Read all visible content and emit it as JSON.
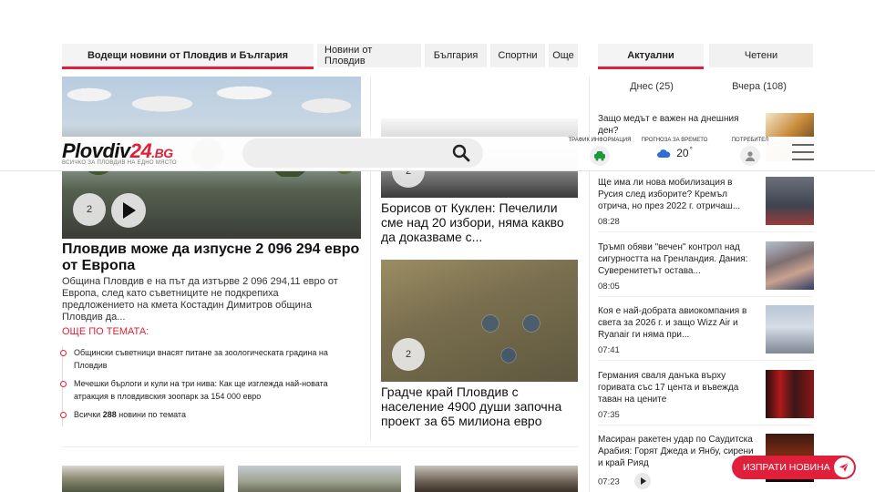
{
  "tabs": {
    "main": "Водещи новини от Пловдив и България",
    "plovdiv": "Новини от Пловдив",
    "bulgaria": "България",
    "sports": "Спортни",
    "more": "Още"
  },
  "right_tabs": {
    "current": "Актуални",
    "read": "Четени"
  },
  "days": {
    "today": "Днес (25)",
    "yesterday": "Вчера (108)"
  },
  "header": {
    "logo_main": "Plovdiv",
    "logo_num": "24",
    "logo_bg": ".BG",
    "logo_sub": "ВСИЧКО ЗА ПЛОВДИВ НА ЕДНО МЯСТО",
    "search_placeholder": "",
    "traffic_label": "ТРАФИК ИНФОРМАЦИЯ",
    "weather_label": "ПРОГНОЗА ЗА ВРЕМЕТО",
    "temperature": "20",
    "temperature_unit": "°",
    "user_label": "ПОТРЕБИТЕЛ"
  },
  "main_article": {
    "comments": "2",
    "title": "Пловдив може да изпусне 2 096 294 евро от Европа",
    "lead": "Община Пловдив е на път да изтърве 2 096 294,11 евро от Европа, след като съветниците не подкрепиха предложението на кмета Костадин Димитров община Пловдив да...",
    "related_header": "ОЩЕ ПО ТЕМАТА:",
    "related": [
      "Общински съветници внасят питане за зоологическата градина на Пловдив",
      "Мечешки бърлоги и кули на три нива: Как ще изглежда най-новата атракция в пловдивския зоопарк за 154 000 евро"
    ],
    "all_prefix": "Всички",
    "all_count": "288",
    "all_suffix": "новини по темата"
  },
  "mid_articles": [
    {
      "comments": "2",
      "title": "Борисов от Куклен: Печелили сме над 20 избори, няма какво да доказваме с..."
    },
    {
      "comments": "2",
      "title": "Градче край Пловдив с население 4900 души започна проект за 65 милиона евро"
    }
  ],
  "news": [
    {
      "title": "Защо медът е важен на днешния ден?",
      "time": ""
    },
    {
      "title": "Ще има ли нова мобилизация в Русия след изборите? Кремъл отрича, но през 2022 г. отричаш...",
      "time": "08:28"
    },
    {
      "title": "Тръмп обяви \"вечен\" контрол над сигурността на Гренландия. Дания: Суверенитетът остава...",
      "time": "08:05"
    },
    {
      "title": "Коя е най-добрата авиокомпания в света за 2026 г. и защо Wizz Air и Ryanair ги няма при...",
      "time": "07:41"
    },
    {
      "title": "Германия сваля данъка върху горивата със 17 цента и въвежда таван на цените",
      "time": "07:35"
    },
    {
      "title": "Масиран ракетен удар по Саудитска Арабия: Горят Джеда и Янбу, сирени и край Рияд",
      "time": "07:23"
    }
  ],
  "send_news": "ИЗПРАТИ НОВИНА",
  "colors": {
    "accent": "#e0203a"
  }
}
